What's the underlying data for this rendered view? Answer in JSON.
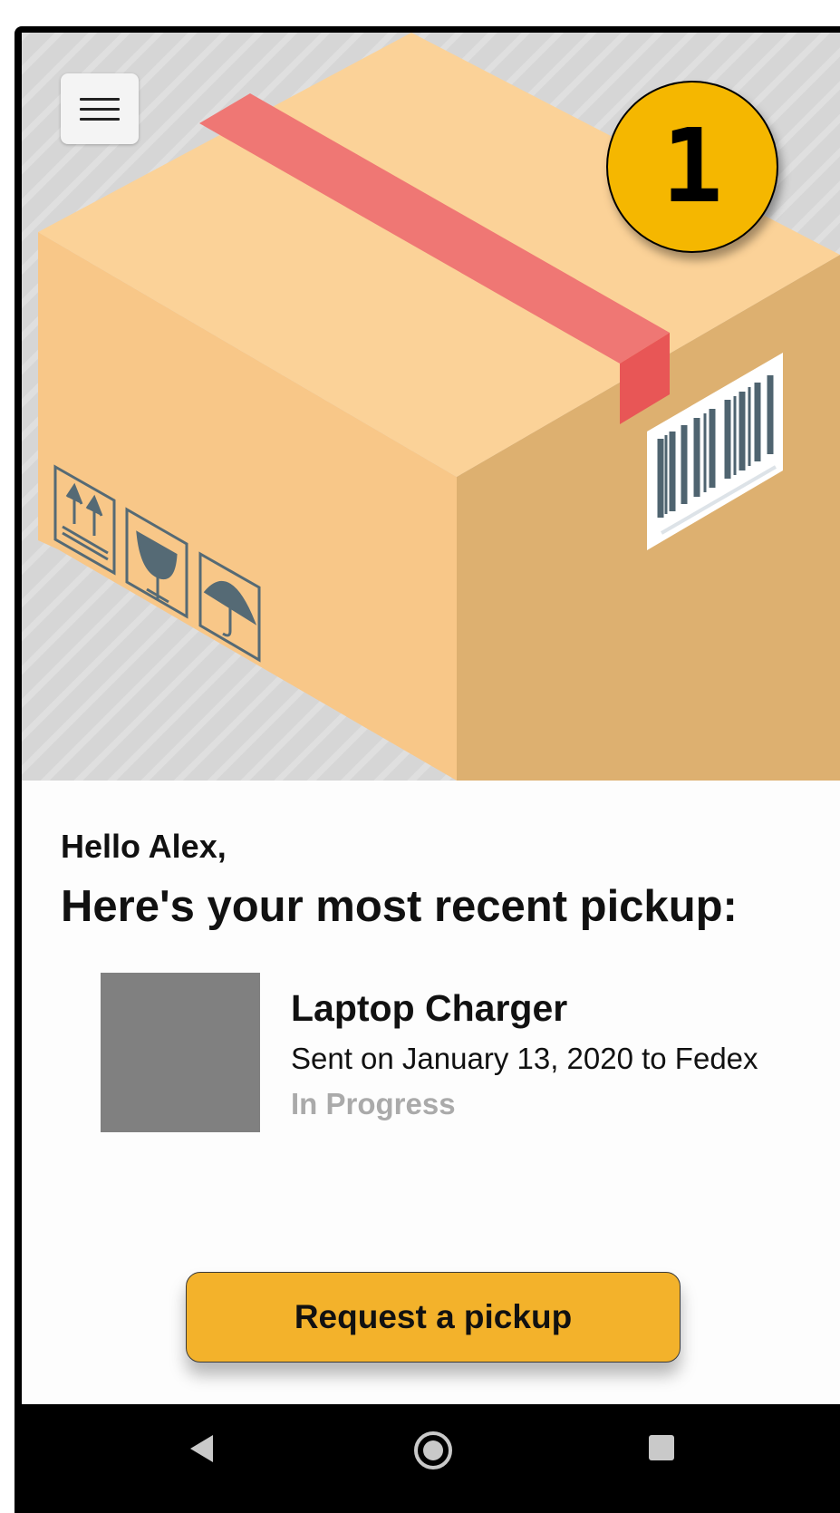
{
  "header": {
    "step_number": "1",
    "menu_icon": "hamburger-menu-icon",
    "illustration": "cardboard-box-illustration"
  },
  "greeting": "Hello Alex,",
  "headline": "Here's your most recent pickup:",
  "recent_pickup": {
    "item_name": "Laptop Charger",
    "details": "Sent on January 13, 2020 to Fedex",
    "status": "In Progress"
  },
  "actions": {
    "request_pickup_label": "Request a pickup"
  },
  "navigation": {
    "back_icon": "back-triangle-icon",
    "home_icon": "home-circle-icon",
    "recents_icon": "recents-square-icon"
  },
  "colors": {
    "accent": "#f3b22b",
    "badge": "#f5b700",
    "status_text": "#aaaaaa",
    "thumbnail": "#808080"
  }
}
